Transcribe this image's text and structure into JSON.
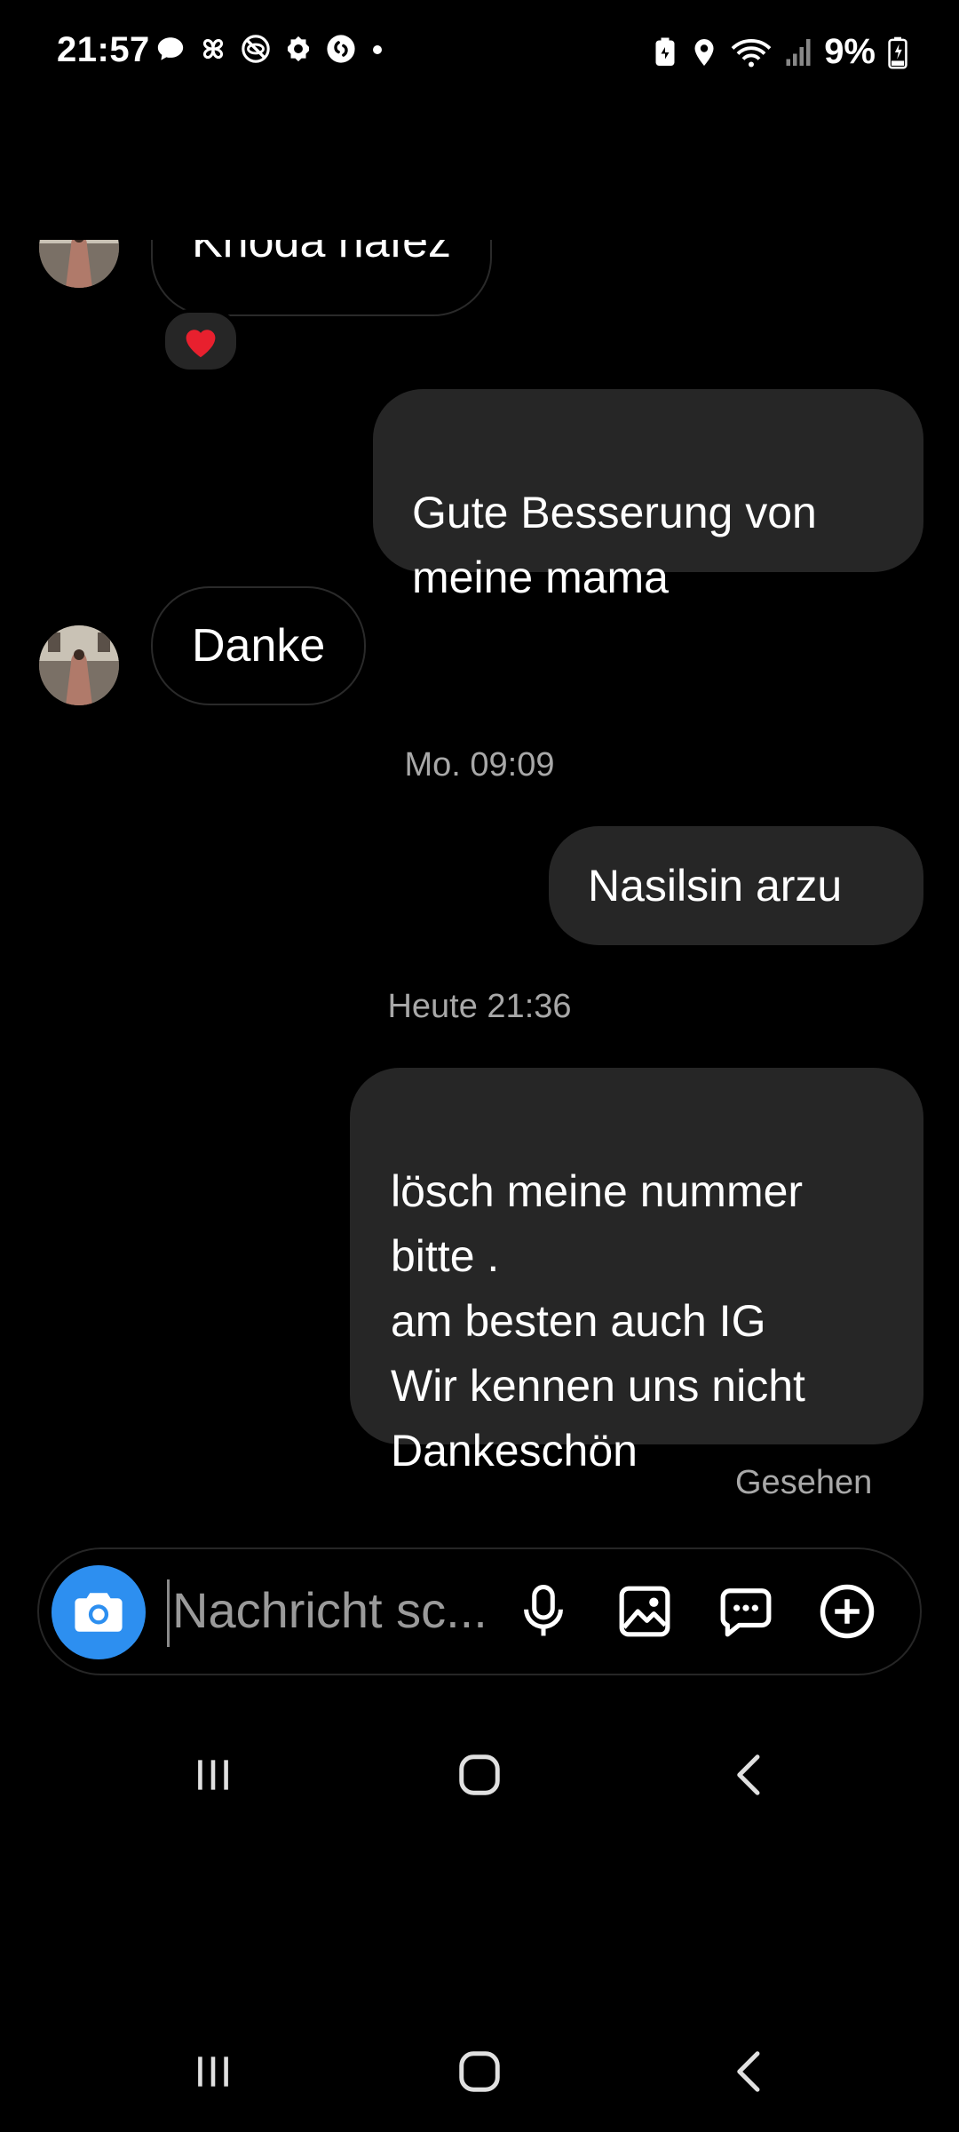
{
  "status_bar": {
    "time": "21:57",
    "battery_percent": "9%",
    "left_icons": [
      "chat-bubble-icon",
      "pinwheel-icon",
      "no-eye-icon",
      "settings-cog-icon",
      "shazam-icon",
      "dot-icon"
    ],
    "right_icons": [
      "battery-saver-icon",
      "location-icon",
      "wifi-icon",
      "signal-icon",
      "battery-charging-icon"
    ]
  },
  "conversation": {
    "messages": [
      {
        "from": "them",
        "text": "Khoda hafez",
        "reaction": "heart"
      },
      {
        "from": "me",
        "text": "Gute Besserung von\nmeine mama"
      },
      {
        "from": "them",
        "text": "Danke"
      },
      {
        "timestamp": "Mo. 09:09"
      },
      {
        "from": "me",
        "text": "Nasilsin arzu"
      },
      {
        "timestamp": "Heute 21:36"
      },
      {
        "from": "me",
        "text": "lösch meine nummer\nbitte .\nam besten auch IG\nWir kennen uns nicht\nDankeschön"
      }
    ],
    "seen_label": "Gesehen"
  },
  "composer": {
    "placeholder": "Nachricht sc...",
    "icons": [
      "camera-icon",
      "microphone-icon",
      "gallery-icon",
      "sticker-chat-icon",
      "plus-circle-icon"
    ]
  },
  "colors": {
    "background": "#000000",
    "bubble_out": "#262626",
    "camera_button": "#2d8ff0",
    "heart": "#e8202e",
    "muted_text": "#a8a8a8"
  },
  "navigation": {
    "buttons": [
      "recent-apps",
      "home",
      "back"
    ]
  }
}
